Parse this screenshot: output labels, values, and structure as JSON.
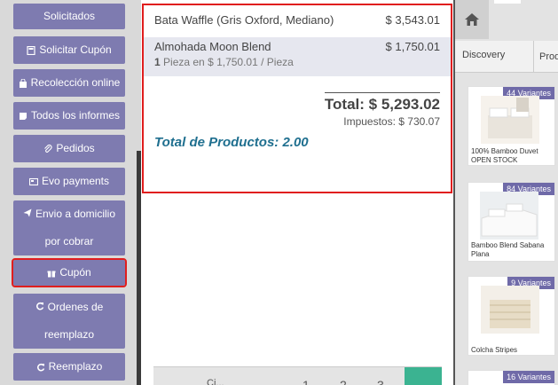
{
  "left_buttons": [
    {
      "id": "solicitados",
      "label": "Solicitados",
      "icon": ""
    },
    {
      "id": "solicitar-cupon",
      "label": "Solicitar Cupón",
      "icon": "calculator-icon"
    },
    {
      "id": "recoleccion",
      "label": "Recolección online",
      "icon": "shopping-bag-icon"
    },
    {
      "id": "informes",
      "label": "Todos los informes",
      "icon": "sticky-note-icon"
    },
    {
      "id": "pedidos",
      "label": "Pedidos",
      "icon": "paperclip-icon"
    },
    {
      "id": "evo",
      "label": "Evo payments",
      "icon": "card-icon"
    },
    {
      "id": "envio",
      "label_line1": "Envio a domicilio",
      "label_line2": "por cobrar",
      "icon": "paper-plane-icon"
    },
    {
      "id": "cupon",
      "label": "Cupón",
      "icon": "gift-icon"
    },
    {
      "id": "ordenes",
      "label_line1": "Ordenes de",
      "label_line2": "reemplazo",
      "icon": "refresh-icon"
    },
    {
      "id": "reemplazo",
      "label": "Reemplazo",
      "icon": "refresh-icon"
    }
  ],
  "order": {
    "lines": [
      {
        "name": "Bata Waffle (Gris Oxford, Mediano)",
        "amount": "$ 3,543.01"
      },
      {
        "name": "Almohada Moon Blend",
        "amount": "$ 1,750.01",
        "qty": "1",
        "qty_text": "Pieza en $ 1,750.01 / Pieza"
      }
    ],
    "total": "Total: $ 5,293.02",
    "taxes": "Impuestos: $ 730.07",
    "product_total": "Total de Productos: 2.00"
  },
  "numpad": {
    "keys": [
      "1",
      "2",
      "3"
    ],
    "partial_label": "Ci..."
  },
  "right_panel": {
    "tabs": [
      "Discovery",
      "Prod"
    ],
    "products": [
      {
        "badge": "44 Variantes",
        "name": "100% Bamboo Duvet OPEN STOCK"
      },
      {
        "badge": "84 Variantes",
        "name": "Bamboo Blend Sabana Plana"
      },
      {
        "badge": "9 Variantes",
        "name": "Colcha Stripes"
      },
      {
        "badge": "16 Variantes",
        "name": ""
      }
    ]
  },
  "colors": {
    "button": "#7e7bb0",
    "highlight": "#e01e1e",
    "accent_text": "#1f6f8f",
    "green": "#3bb391"
  }
}
